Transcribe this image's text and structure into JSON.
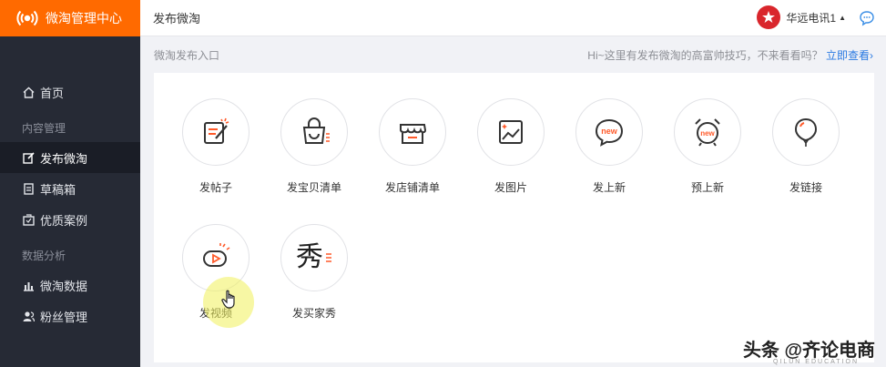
{
  "app": {
    "name": "微淘管理中心",
    "brand_color": "#ff6a00"
  },
  "sidebar": {
    "items": [
      {
        "label": "首页",
        "icon": "home-icon",
        "active": false
      },
      {
        "group": "内容管理"
      },
      {
        "label": "发布微淘",
        "icon": "edit-icon",
        "active": true
      },
      {
        "label": "草稿箱",
        "icon": "draft-icon",
        "active": false
      },
      {
        "label": "优质案例",
        "icon": "case-icon",
        "active": false
      },
      {
        "group": "数据分析"
      },
      {
        "label": "微淘数据",
        "icon": "bar-chart-icon",
        "active": false
      },
      {
        "label": "粉丝管理",
        "icon": "fans-icon",
        "active": false
      }
    ]
  },
  "header": {
    "title": "发布微淘",
    "user_name": "华远电讯1",
    "message_icon": "chat-bubble-icon"
  },
  "subheader": {
    "breadcrumb": "微淘发布入口",
    "tip_text": "Hi~这里有发布微淘的高富帅技巧，不来看看吗？",
    "tip_link": "立即查看",
    "tip_link_arrow": "›",
    "link_color": "#2a7ae2"
  },
  "entries": [
    {
      "label": "发帖子",
      "icon": "post-edit-icon"
    },
    {
      "label": "发宝贝清单",
      "icon": "shopping-bag-icon"
    },
    {
      "label": "发店铺清单",
      "icon": "store-icon"
    },
    {
      "label": "发图片",
      "icon": "image-icon"
    },
    {
      "label": "发上新",
      "icon": "new-chat-icon",
      "badge": "new"
    },
    {
      "label": "预上新",
      "icon": "new-alarm-icon",
      "badge": "new"
    },
    {
      "label": "发链接",
      "icon": "balloon-link-icon"
    },
    {
      "label": "发视频",
      "icon": "video-play-icon"
    },
    {
      "label": "发买家秀",
      "icon": "buyer-show-icon",
      "glyph": "秀"
    }
  ],
  "watermark": {
    "text": "头条 @齐论电商",
    "sub": "QILUN EDUCATION"
  }
}
